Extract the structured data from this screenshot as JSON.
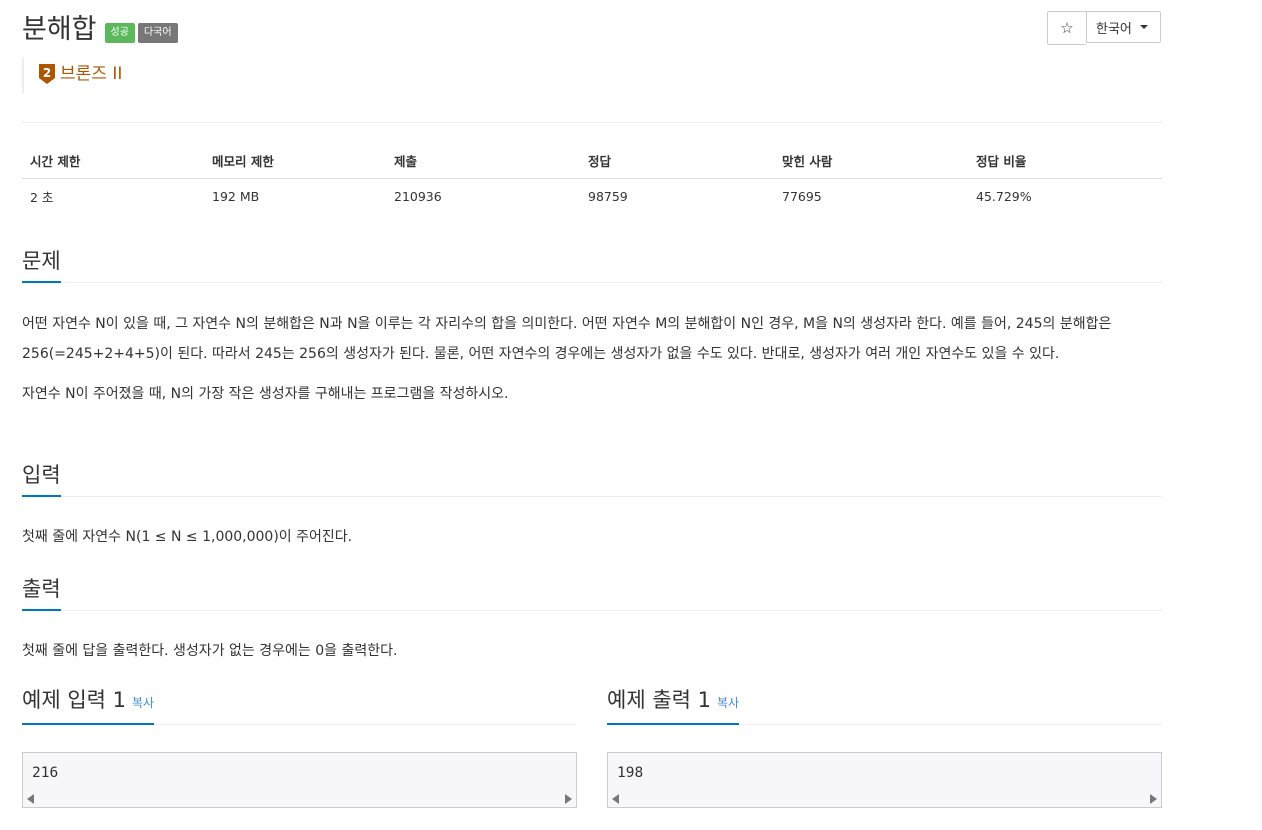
{
  "header": {
    "title": "분해합",
    "badges": {
      "success": "성공",
      "multilang": "다국어"
    },
    "tier": {
      "label": "브론즈 II",
      "level": "2",
      "color": "#ad5600"
    },
    "star_icon": "☆",
    "language": "한국어"
  },
  "info_table": {
    "headers": [
      "시간 제한",
      "메모리 제한",
      "제출",
      "정답",
      "맞힌 사람",
      "정답 비율"
    ],
    "values": [
      "2 초",
      "192 MB",
      "210936",
      "98759",
      "77695",
      "45.729%"
    ]
  },
  "sections": {
    "problem": {
      "title": "문제",
      "paragraphs": [
        "어떤 자연수 N이 있을 때, 그 자연수 N의 분해합은 N과 N을 이루는 각 자리수의 합을 의미한다. 어떤 자연수 M의 분해합이 N인 경우, M을 N의 생성자라 한다. 예를 들어, 245의 분해합은 256(=245+2+4+5)이 된다. 따라서 245는 256의 생성자가 된다. 물론, 어떤 자연수의 경우에는 생성자가 없을 수도 있다. 반대로, 생성자가 여러 개인 자연수도 있을 수 있다.",
        "자연수 N이 주어졌을 때, N의 가장 작은 생성자를 구해내는 프로그램을 작성하시오."
      ]
    },
    "input": {
      "title": "입력",
      "text": "첫째 줄에 자연수 N(1 ≤ N ≤ 1,000,000)이 주어진다."
    },
    "output": {
      "title": "출력",
      "text": "첫째 줄에 답을 출력한다. 생성자가 없는 경우에는 0을 출력한다."
    }
  },
  "samples": {
    "input": {
      "title": "예제 입력 1",
      "copy": "복사",
      "value": "216"
    },
    "output": {
      "title": "예제 출력 1",
      "copy": "복사",
      "value": "198"
    }
  },
  "colors": {
    "accent": "#0076c0",
    "success": "#5cb85c",
    "multilang": "#777777",
    "link": "#428bca"
  }
}
